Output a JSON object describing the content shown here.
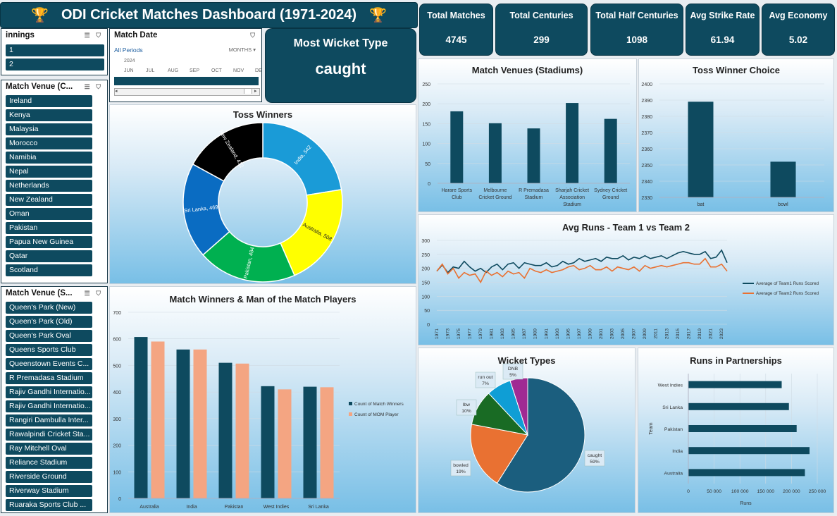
{
  "title": "ODI Cricket Matches Dashboard (1971-2024)",
  "kpis": [
    {
      "label": "Total Matches",
      "value": "4745"
    },
    {
      "label": "Total Centuries",
      "value": "299"
    },
    {
      "label": "Total Half Centuries",
      "value": "1098"
    },
    {
      "label": "Avg Strike Rate",
      "value": "61.94"
    },
    {
      "label": "Avg Economy",
      "value": "5.02"
    }
  ],
  "most_wicket": {
    "label": "Most Wicket Type",
    "value": "caught"
  },
  "slicer_innings": {
    "title": "innings",
    "items": [
      "1",
      "2"
    ]
  },
  "slicer_country": {
    "title": "Match Venue (C...",
    "items": [
      "Ireland",
      "Kenya",
      "Malaysia",
      "Morocco",
      "Namibia",
      "Nepal",
      "Netherlands",
      "New Zealand",
      "Oman",
      "Pakistan",
      "Papua New Guinea",
      "Qatar",
      "Scotland"
    ]
  },
  "slicer_stadium": {
    "title": "Match Venue (S...",
    "items": [
      "Queen's Park (New)",
      "Queen's Park (Old)",
      "Queen's Park Oval",
      "Queens Sports Club",
      "Queenstown Events C...",
      "R Premadasa Stadium",
      "Rajiv Gandhi Internatio...",
      "Rajiv Gandhi Internatio...",
      "Rangiri Dambulla Inter...",
      "Rawalpindi Cricket Sta...",
      "Ray Mitchell Oval",
      "Reliance Stadium",
      "Riverside Ground",
      "Riverway Stadium",
      "Ruaraka Sports Club ..."
    ]
  },
  "timeline": {
    "title": "Match Date",
    "all_periods": "All Periods",
    "unit": "MONTHS",
    "year": "2024",
    "months": [
      "JUN",
      "JUL",
      "AUG",
      "SEP",
      "OCT",
      "NOV",
      "DE"
    ]
  },
  "colors": {
    "dark": "#0e4a5f",
    "orange": "#e97132",
    "salmon": "#f4a582"
  },
  "chart_data": [
    {
      "id": "toss_winners",
      "type": "pie",
      "title": "Toss Winners",
      "categories": [
        "India",
        "Australia",
        "Pakistan",
        "Sri Lanka",
        "New Zealand"
      ],
      "values": [
        542,
        508,
        484,
        469,
        412
      ],
      "colors": [
        "#1a9bd7",
        "#ffff00",
        "#00b050",
        "#0a6cc2",
        "#000000"
      ],
      "donut": true
    },
    {
      "id": "venues",
      "type": "bar",
      "title": "Match Venues (Stadiums)",
      "categories": [
        "Harare Sports Club",
        "Melbourne Cricket Ground",
        "R Premadasa Stadium",
        "Sharjah Cricket Association Stadium",
        "Sydney Cricket Ground"
      ],
      "values": [
        181,
        151,
        138,
        202,
        162
      ],
      "ylim": [
        0,
        250
      ],
      "yticks": [
        0,
        50,
        100,
        150,
        200,
        250
      ]
    },
    {
      "id": "toss_choice",
      "type": "bar",
      "title": "Toss Winner Choice",
      "categories": [
        "bat",
        "bowl"
      ],
      "values": [
        2389,
        2352
      ],
      "ylim": [
        2330,
        2400
      ],
      "yticks": [
        2330,
        2340,
        2350,
        2360,
        2370,
        2380,
        2390,
        2400
      ]
    },
    {
      "id": "avg_runs",
      "type": "line",
      "title": "Avg Runs - Team 1 vs Team 2",
      "x": [
        1971,
        1972,
        1973,
        1974,
        1975,
        1976,
        1977,
        1978,
        1979,
        1980,
        1981,
        1982,
        1983,
        1984,
        1985,
        1986,
        1987,
        1988,
        1989,
        1990,
        1991,
        1992,
        1993,
        1994,
        1995,
        1996,
        1997,
        1998,
        1999,
        2000,
        2001,
        2002,
        2003,
        2004,
        2005,
        2006,
        2007,
        2008,
        2009,
        2010,
        2011,
        2012,
        2013,
        2014,
        2015,
        2016,
        2017,
        2018,
        2019,
        2020,
        2021,
        2022,
        2023,
        2024
      ],
      "xticks": [
        1971,
        1973,
        1975,
        1977,
        1979,
        1981,
        1983,
        1985,
        1987,
        1989,
        1991,
        1993,
        1995,
        1997,
        1999,
        2001,
        2003,
        2005,
        2007,
        2009,
        2011,
        2013,
        2015,
        2017,
        2019,
        2021,
        2023
      ],
      "ylim": [
        0,
        300
      ],
      "yticks": [
        0,
        50,
        100,
        150,
        200,
        250,
        300
      ],
      "series": [
        {
          "name": "Average of Team1 Runs Scored",
          "color": "#0e4a5f",
          "values": [
            190,
            212,
            185,
            205,
            200,
            225,
            205,
            190,
            200,
            185,
            205,
            215,
            195,
            215,
            220,
            200,
            220,
            215,
            210,
            210,
            220,
            205,
            210,
            225,
            215,
            220,
            235,
            225,
            230,
            235,
            225,
            240,
            235,
            235,
            245,
            230,
            240,
            235,
            245,
            235,
            240,
            245,
            235,
            245,
            255,
            260,
            255,
            250,
            250,
            260,
            235,
            240,
            265,
            220
          ]
        },
        {
          "name": "Average of Team2 Runs Scored",
          "color": "#e97132",
          "values": [
            190,
            215,
            180,
            200,
            165,
            185,
            175,
            180,
            150,
            190,
            175,
            185,
            170,
            190,
            180,
            185,
            165,
            200,
            190,
            185,
            195,
            185,
            190,
            195,
            205,
            210,
            195,
            200,
            210,
            195,
            195,
            205,
            190,
            205,
            200,
            195,
            205,
            190,
            210,
            200,
            205,
            210,
            205,
            210,
            215,
            220,
            220,
            215,
            215,
            235,
            205,
            205,
            215,
            190
          ]
        }
      ]
    },
    {
      "id": "mom",
      "type": "bar",
      "title": "Match Winners & Man of the Match Players",
      "categories": [
        "Australia",
        "India",
        "Pakistan",
        "West Indies",
        "Sri Lanka"
      ],
      "ylim": [
        0,
        700
      ],
      "yticks": [
        0,
        100,
        200,
        300,
        400,
        500,
        600,
        700
      ],
      "series": [
        {
          "name": "Count of Match Winners",
          "color": "#0e4a5f",
          "values": [
            607,
            560,
            510,
            422,
            420
          ]
        },
        {
          "name": "Count of MOM Player",
          "color": "#f4a582",
          "values": [
            590,
            560,
            507,
            410,
            418
          ]
        }
      ]
    },
    {
      "id": "wickets",
      "type": "pie",
      "title": "Wicket Types",
      "categories": [
        "caught",
        "bowled",
        "lbw",
        "run out",
        "DNB"
      ],
      "values": [
        59,
        19,
        10,
        7,
        5
      ],
      "labels": [
        [
          "caught",
          "59%"
        ],
        [
          "bowled",
          "19%"
        ],
        [
          "lbw",
          "10%"
        ],
        [
          "run out",
          "7%"
        ],
        [
          "DNB",
          "5%"
        ]
      ],
      "colors": [
        "#1b5e7e",
        "#e97132",
        "#196b24",
        "#0f9ed5",
        "#a02b93"
      ]
    },
    {
      "id": "partnerships",
      "type": "bar",
      "orientation": "horizontal",
      "title": "Runs in Partnerships",
      "categories": [
        "West Indies",
        "Sri Lanka",
        "Pakistan",
        "India",
        "Australia"
      ],
      "values": [
        181000,
        195000,
        210000,
        235000,
        226000
      ],
      "xlim": [
        0,
        250000
      ],
      "xticks": [
        0,
        50000,
        100000,
        150000,
        200000,
        250000
      ],
      "xlabel": "Runs",
      "ylabel": "Team"
    }
  ]
}
